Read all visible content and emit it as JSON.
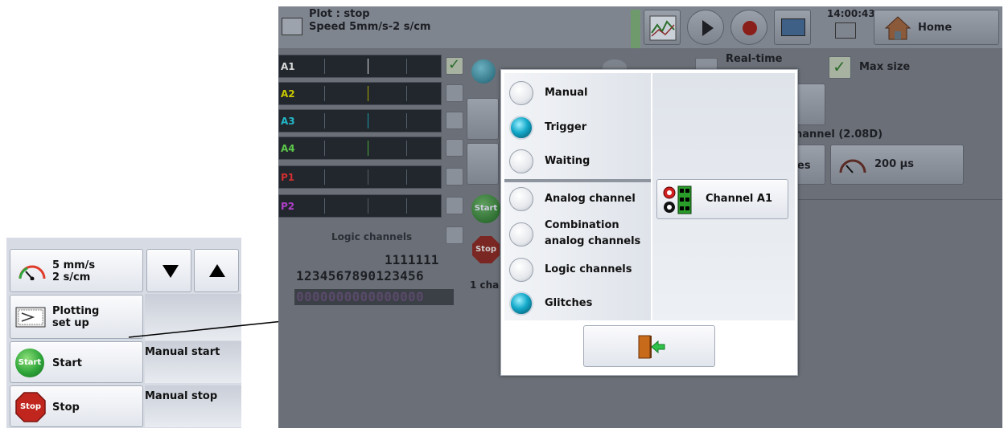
{
  "left_panel": {
    "speed_line1": "5 mm/s",
    "speed_line2": "2 s/cm",
    "plotting_line1": "Plotting",
    "plotting_line2": "set up",
    "start_icon_text": "Start",
    "start_label": "Start",
    "start_desc": "Manual start",
    "stop_icon_text": "Stop",
    "stop_label": "Stop",
    "stop_desc": "Manual stop"
  },
  "screen": {
    "status_line1": "Plot : stop",
    "status_line2": "Speed 5mm/s-2 s/cm",
    "time": "14:00:43",
    "home_label": "Home",
    "channels": [
      "A1",
      "A2",
      "A3",
      "A4",
      "P1",
      "P2"
    ],
    "channel_colors": [
      "#ffffff",
      "#c8c800",
      "#22b8c8",
      "#5cc84a",
      "#d03030",
      "#b040c8"
    ],
    "realtime_label": "Real-time",
    "maxsize_label": "Max size",
    "channel_info": "hannel  (2.08D)",
    "time_value": "200 µs",
    "partial_es": "es",
    "partial_start": "Start",
    "partial_stop": "Stop",
    "logic_channels_label": "Logic channels",
    "digits_top": "1111111",
    "digits_bottom": "1234567890123456",
    "digits_zero": "0000000000000000",
    "one_cha": "1 cha"
  },
  "dialog": {
    "options_top": [
      {
        "label": "Manual",
        "selected": false
      },
      {
        "label": "Trigger",
        "selected": true
      },
      {
        "label": "Waiting",
        "selected": false
      }
    ],
    "options_bottom": [
      {
        "label": "Analog channel",
        "selected": false
      },
      {
        "label": "Combination analog channels",
        "line1": "Combination",
        "line2": "analog channels",
        "selected": false
      },
      {
        "label": "Logic channels",
        "selected": false
      },
      {
        "label": "Glitches",
        "selected": true
      }
    ],
    "channel_button_label": "Channel A1",
    "exit_icon": "exit-door-icon"
  },
  "colors": {
    "radio_selected": "#13a9c9",
    "start_green": "#2fa53a",
    "stop_red": "#c0261e",
    "exit_green": "#2fc24a"
  }
}
